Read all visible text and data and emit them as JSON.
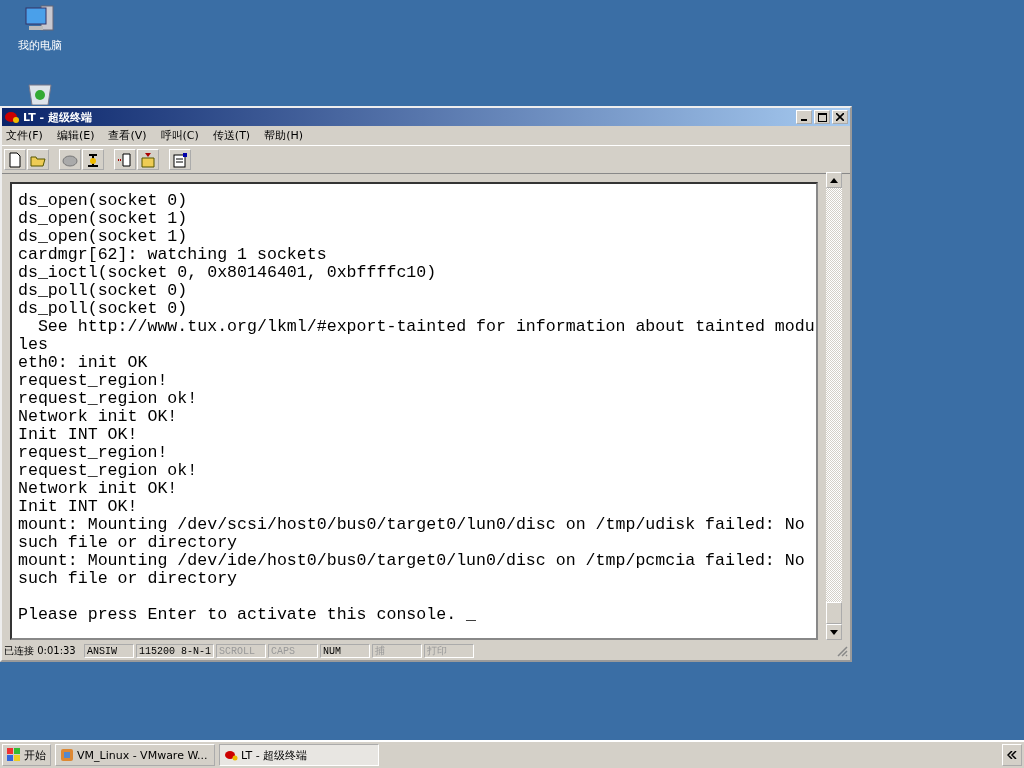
{
  "desktop_icons": [
    {
      "label": "我的电脑",
      "kind": "computer"
    },
    {
      "kind": "recycle"
    }
  ],
  "window": {
    "title": "LT - 超级终端"
  },
  "menu": [
    "文件(F)",
    "编辑(E)",
    "查看(V)",
    "呼叫(C)",
    "传送(T)",
    "帮助(H)"
  ],
  "terminal_blocks": [
    [
      "ds_open(socket 0)",
      "ds_open(socket 1)",
      "ds_open(socket 1)",
      "cardmgr[62]: watching 1 sockets",
      "ds_ioctl(socket 0, 0x80146401, 0xbffffc10)",
      "ds_poll(socket 0)",
      "ds_poll(socket 0)",
      "  See http://www.tux.org/lkml/#export-tainted for information about tainted modu",
      "les",
      "eth0: init OK",
      "request_region!",
      "request_region ok!",
      "Network init OK!",
      "Init INT OK!",
      "request_region!",
      "request_region ok!",
      "Network init OK!",
      "Init INT OK!",
      "mount: Mounting /dev/scsi/host0/bus0/target0/lun0/disc on /tmp/udisk failed: No",
      "such file or directory",
      "mount: Mounting /dev/ide/host0/bus0/target0/lun0/disc on /tmp/pcmcia failed: No",
      "such file or directory"
    ],
    [
      "Please press Enter to activate this console. _"
    ]
  ],
  "status_bar": [
    {
      "text": "已连接 0:01:33",
      "active": true
    },
    {
      "text": "ANSIW",
      "active": true
    },
    {
      "text": "115200 8-N-1",
      "active": true
    },
    {
      "text": "SCROLL",
      "active": false
    },
    {
      "text": "CAPS",
      "active": false
    },
    {
      "text": "NUM",
      "active": true
    },
    {
      "text": "捕",
      "active": false
    },
    {
      "text": "打印",
      "active": false
    }
  ],
  "taskbar": {
    "start": "开始",
    "tasks": [
      {
        "label": "VM_Linux - VMware W...",
        "selected": false
      },
      {
        "label": "LT - 超级终端",
        "selected": true
      }
    ]
  }
}
